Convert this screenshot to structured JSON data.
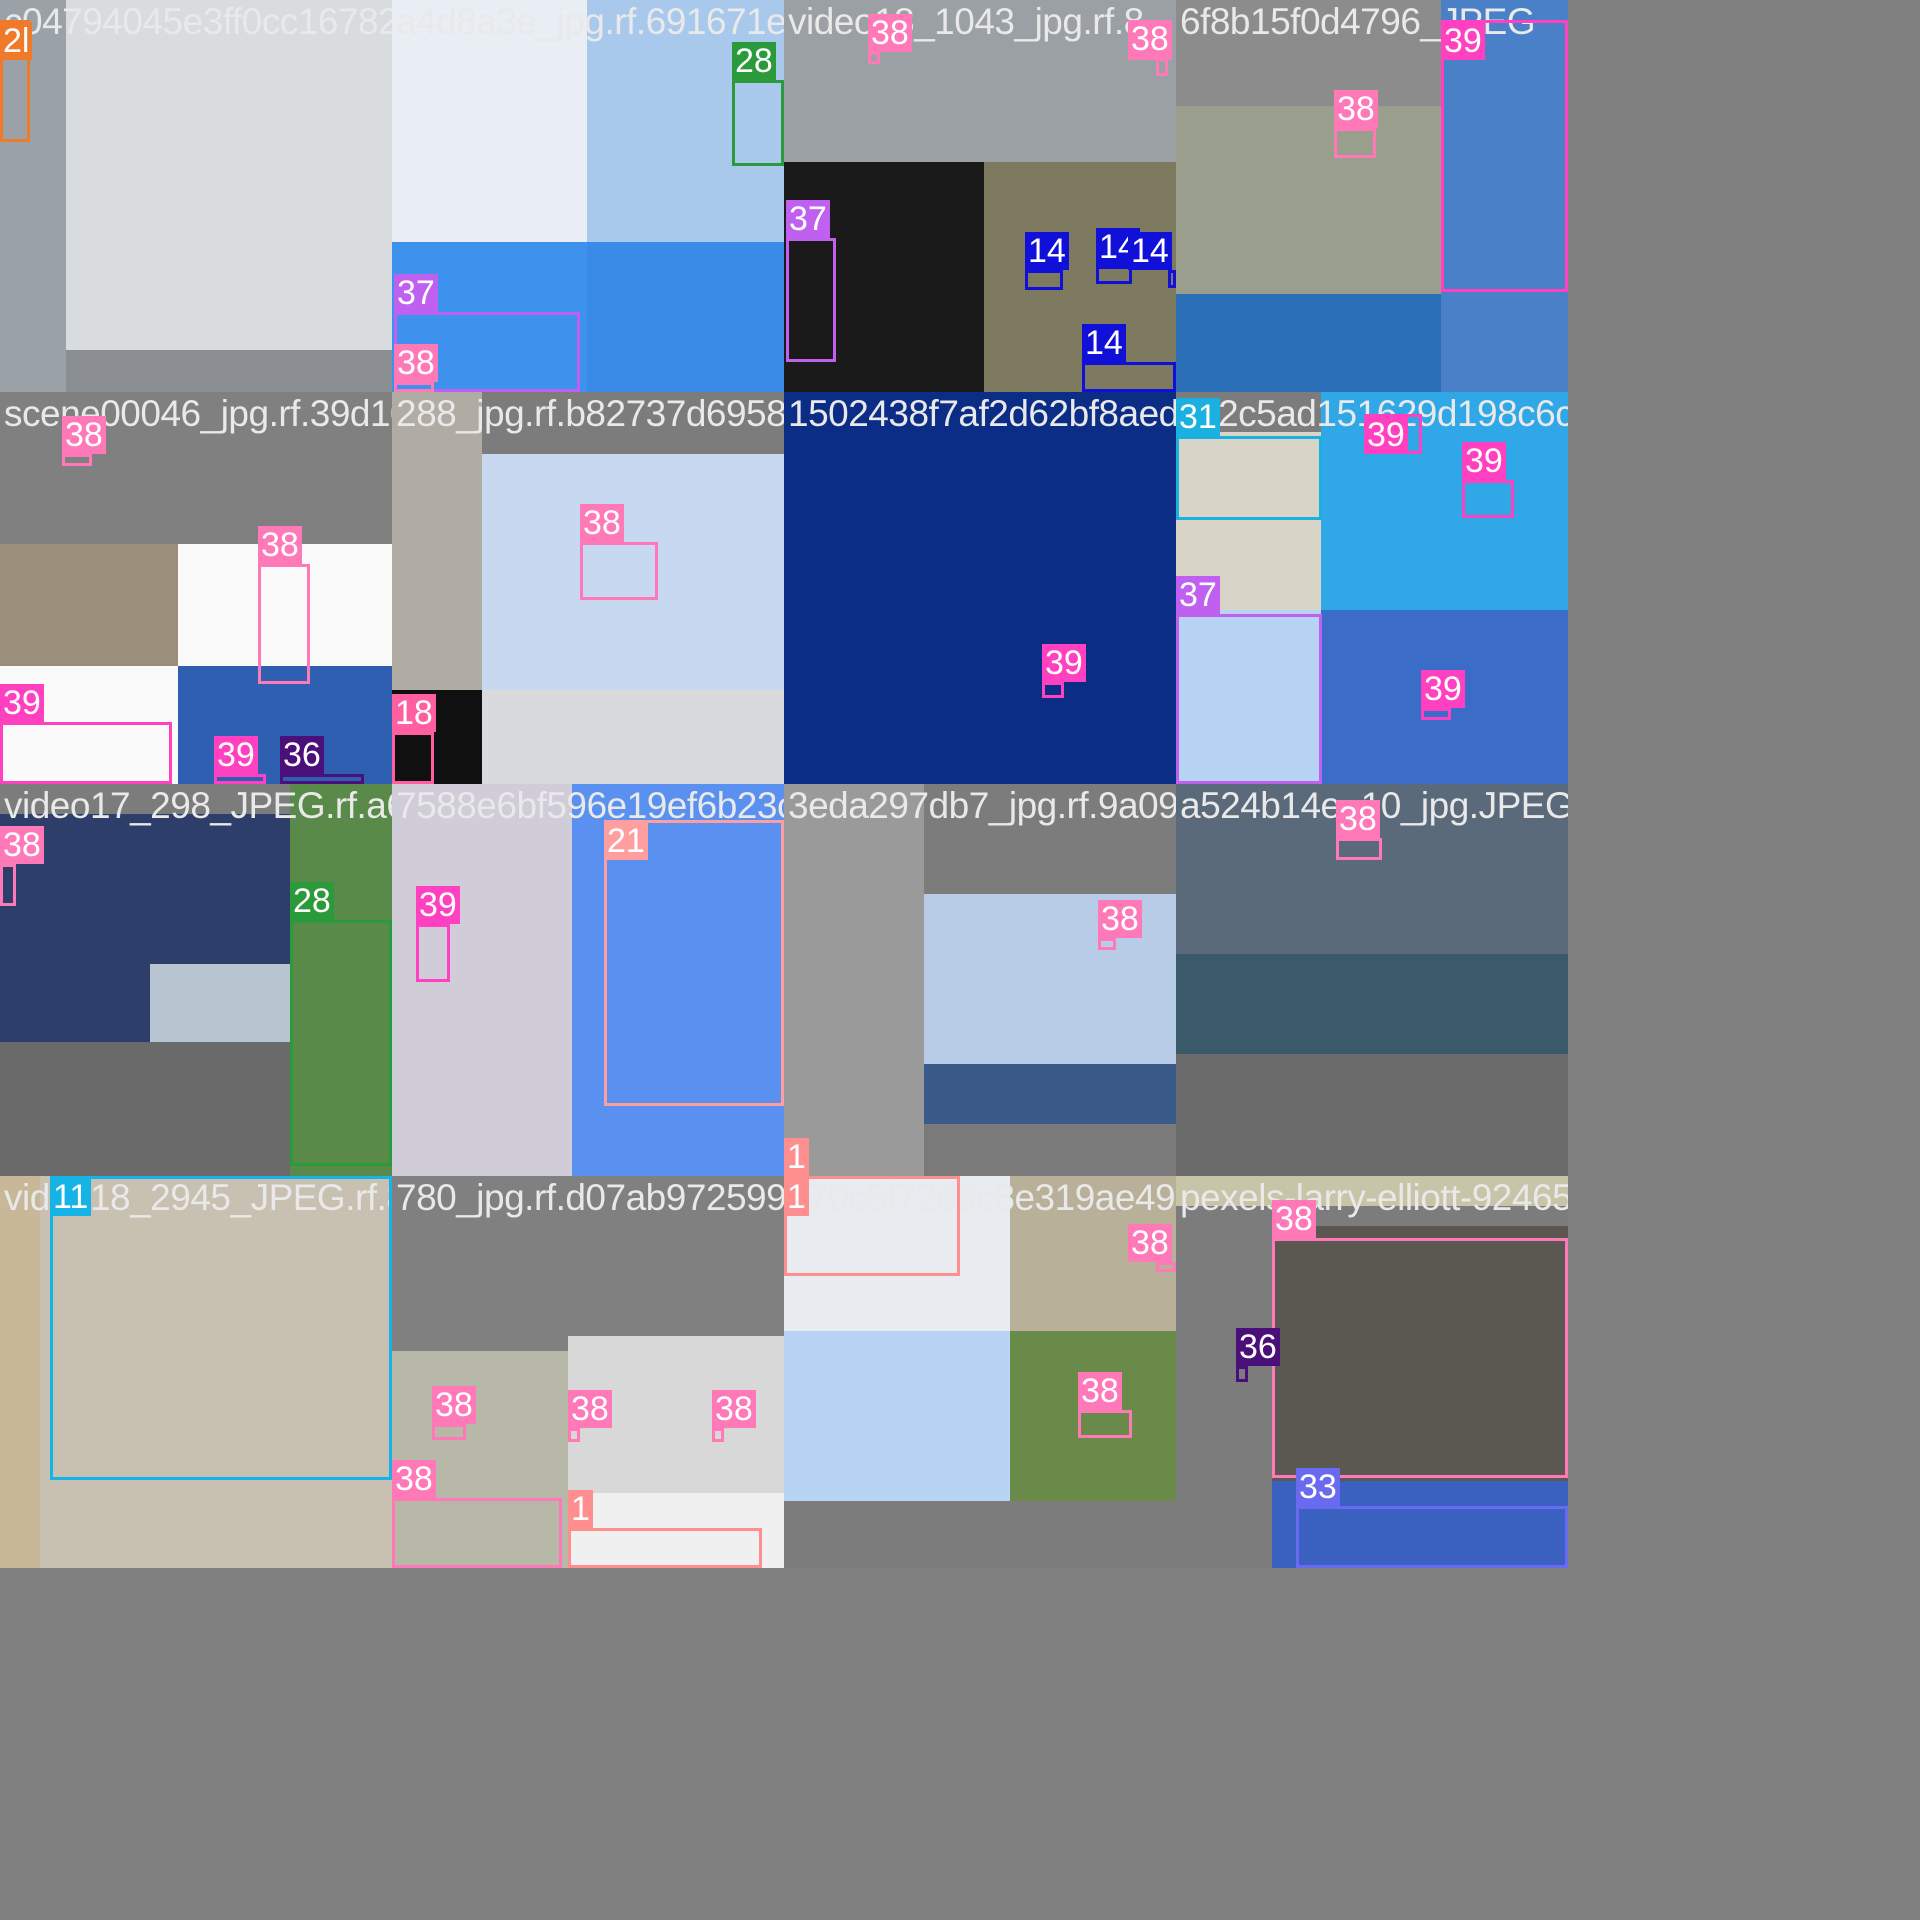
{
  "palette": {
    "1": "#ff8e8e",
    "11": "#16b4e6",
    "14": "#1010d8",
    "18": "#ff5fa0",
    "2l": "#f07a2a",
    "21": "#ff9e9e",
    "28": "#2a9a3a",
    "31": "#1ab0e0",
    "33": "#6a6af0",
    "36": "#4b0f7a",
    "37": "#c060f0",
    "38": "#ff78b8",
    "39": "#ff40c0",
    "fname": "#e9e9e9",
    "gray": "#808080"
  },
  "tiles": [
    {
      "fname": "c04794045e3ff0cc167826",
      "backgrounds": [
        "#9aa2a8",
        "#d8dcdf",
        "#8b8f93"
      ],
      "boxes": [
        {
          "label": "2l"
        }
      ]
    },
    {
      "fname": "a4d8a3e_jpg.rf.691671e1cd9",
      "backgrounds": [
        "#e8eef4",
        "#a9c9ec",
        "#3c92ec",
        "#3a8be8"
      ],
      "boxes": [
        {
          "label": "28"
        },
        {
          "label": "37"
        },
        {
          "label": "38"
        }
      ]
    },
    {
      "fname": "video18_1043_jpg.rf.8",
      "backgrounds": [
        "#9aa0a4",
        "#1a1a1a",
        "#7d7a60",
        "#8a8a8a"
      ],
      "boxes": [
        {
          "label": "38"
        },
        {
          "label": "38"
        },
        {
          "label": "38"
        },
        {
          "label": "37"
        },
        {
          "label": "14"
        },
        {
          "label": "14"
        },
        {
          "label": "14"
        },
        {
          "label": "14"
        }
      ]
    },
    {
      "fname": "6f8b15f0d4796_JPEG",
      "backgrounds": [
        "#8c8c8c",
        "#9a9e8c",
        "#2b6fb8",
        "#4a80c8"
      ],
      "boxes": [
        {
          "label": "38"
        },
        {
          "label": "39"
        }
      ]
    },
    {
      "fname": "scene00046_jpg.rf.39d1098",
      "backgrounds": [
        "#808080",
        "#9a8f7a",
        "#fafafa",
        "#fafafa",
        "#2e5fb0"
      ],
      "boxes": [
        {
          "label": "38"
        },
        {
          "label": "38"
        },
        {
          "label": "39"
        },
        {
          "label": "39"
        },
        {
          "label": "36"
        }
      ]
    },
    {
      "fname": "288_jpg.rf.b82737d695896",
      "backgrounds": [
        "#b0aca4",
        "#c8d8f0",
        "#d8dadc",
        "#101010"
      ],
      "boxes": [
        {
          "label": "38"
        },
        {
          "label": "18"
        }
      ]
    },
    {
      "fname": "1502438f7af2d62bf8aeda217",
      "backgrounds": [
        "#0b2d86"
      ],
      "boxes": [
        {
          "label": "39"
        }
      ]
    },
    {
      "fname": "3c2c5ad151629d198c6cd6",
      "backgrounds": [
        "#d8d4c8",
        "#30a8e8",
        "#b8d4f4",
        "#3a6cc8"
      ],
      "boxes": [
        {
          "label": "31"
        },
        {
          "label": "39"
        },
        {
          "label": "39"
        },
        {
          "label": "37"
        },
        {
          "label": "39"
        }
      ]
    },
    {
      "fname": "video17_298_JPEG.rf.a63c7",
      "backgrounds": [
        "#2d3e6a",
        "#5a8a4a",
        "#b8c4d0",
        "#6a6a6a"
      ],
      "boxes": [
        {
          "label": "38"
        },
        {
          "label": "28"
        }
      ]
    },
    {
      "fname": "7588e6bf596e19ef6b23c288",
      "backgrounds": [
        "#d0ccd8",
        "#5a90f0"
      ],
      "boxes": [
        {
          "label": "39"
        },
        {
          "label": "21"
        }
      ]
    },
    {
      "fname": "3eda297db7_jpg.rf.9a096d6a",
      "backgrounds": [
        "#9a9a9a",
        "#b8cce8",
        "#3a5a8a",
        "#7a7a7a"
      ],
      "boxes": [
        {
          "label": "38"
        },
        {
          "label": "1"
        }
      ]
    },
    {
      "fname": "a524b14e_10_jpg.JPEG.rf.97be7",
      "backgrounds": [
        "#5a6a7a",
        "#3a5a6a",
        "#6c6c6c"
      ],
      "boxes": [
        {
          "label": "38"
        }
      ]
    },
    {
      "fname": "video18_2945_JPEG.rf.8967",
      "backgrounds": [
        "#c8b898",
        "#c8c0b0"
      ],
      "boxes": [
        {
          "label": "11"
        }
      ]
    },
    {
      "fname": "780_jpg.rf.d07ab9725992a895",
      "backgrounds": [
        "#808080",
        "#b8b8a8",
        "#d8d8d8",
        "#f0f0f0"
      ],
      "boxes": [
        {
          "label": "38"
        },
        {
          "label": "38"
        },
        {
          "label": "38"
        },
        {
          "label": "38"
        },
        {
          "label": "1"
        }
      ]
    },
    {
      "fname": "e70c5f72d5c8e319ae495bf3c",
      "backgrounds": [
        "#e8ecf0",
        "#b8b098",
        "#b8d4f4",
        "#6a8a4a"
      ],
      "boxes": [
        {
          "label": "1"
        },
        {
          "label": "38"
        },
        {
          "label": "38"
        }
      ]
    },
    {
      "fname": "pexels-larry-elliott-9246514",
      "backgrounds": [
        "#c8c4a8",
        "#5a5850",
        "#3a60c0"
      ],
      "boxes": [
        {
          "label": "38"
        },
        {
          "label": "36"
        },
        {
          "label": "33"
        }
      ]
    }
  ]
}
